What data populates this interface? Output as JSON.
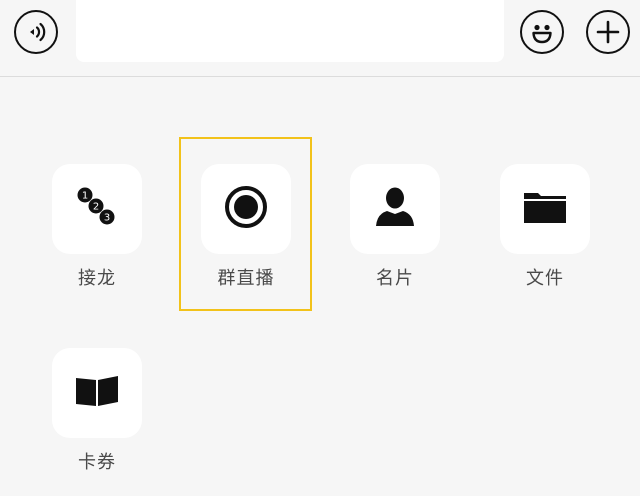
{
  "toolbar": {
    "voice_icon": "voice-waves-icon",
    "input_value": "",
    "emoji_icon": "smiley-icon",
    "plus_icon": "plus-icon"
  },
  "panel": {
    "items": [
      {
        "label": "接龙",
        "icon": "numbered-list-icon"
      },
      {
        "label": "群直播",
        "icon": "record-circle-icon"
      },
      {
        "label": "名片",
        "icon": "person-icon"
      },
      {
        "label": "文件",
        "icon": "folder-icon"
      },
      {
        "label": "卡券",
        "icon": "coupon-cards-icon"
      }
    ]
  },
  "colors": {
    "background": "#f6f6f6",
    "tile": "#ffffff",
    "icon": "#111111",
    "label": "#4a4a4a",
    "highlight": "#f2c21a"
  }
}
